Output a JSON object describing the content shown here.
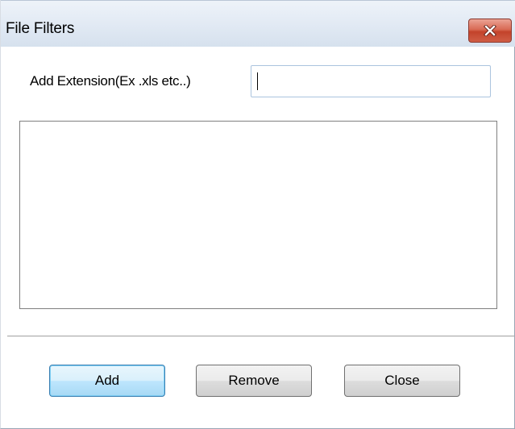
{
  "window": {
    "title": "File Filters",
    "close_icon": "close-x-icon"
  },
  "extension": {
    "label": "Add Extension(Ex .xls etc..)",
    "value": "",
    "placeholder": ""
  },
  "filters_list": {
    "items": []
  },
  "buttons": {
    "add_label": "Add",
    "remove_label": "Remove",
    "close_label": "Close"
  },
  "colors": {
    "close_button": "#c3432b",
    "default_button_border": "#3c7fb1",
    "input_border": "#abc4de"
  }
}
